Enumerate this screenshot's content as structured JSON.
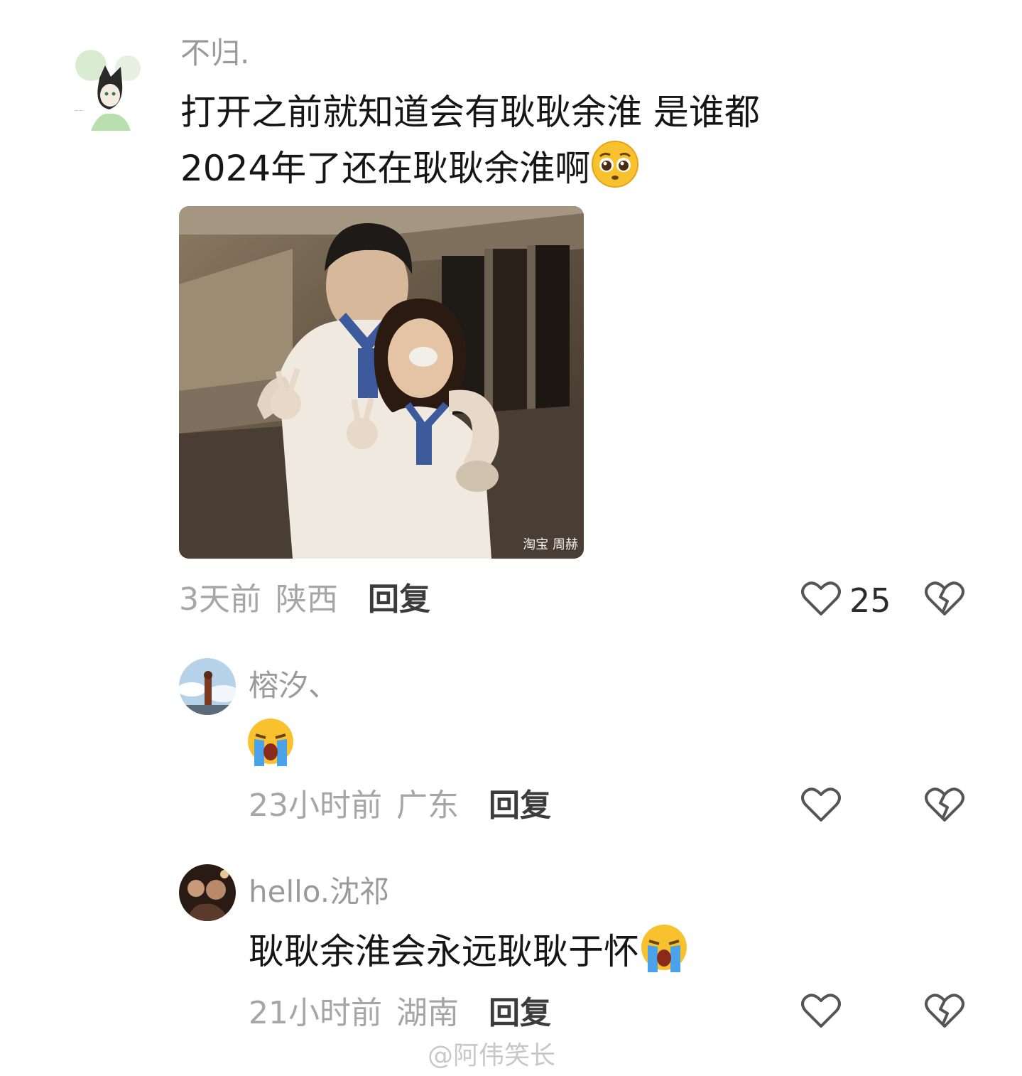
{
  "comments": [
    {
      "username": "不归.",
      "text_line1": "打开之前就知道会有耿耿余淮 是谁都",
      "text_line2": "2024年了还在耿耿余淮啊",
      "emoji": "pleading-face-emoji",
      "time": "3天前",
      "location": "陕西",
      "reply_label": "回复",
      "likes": "25",
      "photo_watermark": "淘宝 周赫"
    },
    {
      "username": "榕汐、",
      "text": "",
      "emoji": "loudly-crying-face-emoji",
      "time": "23小时前",
      "location": "广东",
      "reply_label": "回复"
    },
    {
      "username": "hello.沈祁",
      "text": "耿耿余淮会永远耿耿于怀",
      "emoji": "loudly-crying-face-emoji",
      "time": "21小时前",
      "location": "湖南",
      "reply_label": "回复"
    }
  ],
  "watermark": "@阿伟笑长",
  "colors": {
    "username": "#9a9a9a",
    "meta": "#a6a6a6",
    "reply": "#3c3c3c",
    "icon": "#555555"
  }
}
